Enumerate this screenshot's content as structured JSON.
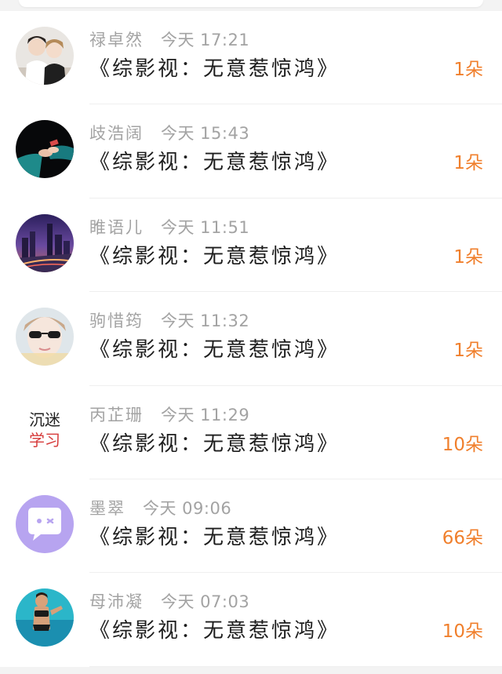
{
  "gifts": [
    {
      "name": "禄卓然",
      "time": "今天 17:21",
      "book": "《综影视：无意惹惊鸿》",
      "amount": "1朵",
      "avatar": "couple-photo-avatar"
    },
    {
      "name": "歧浩阔",
      "time": "今天 15:43",
      "book": "《综影视：无意惹惊鸿》",
      "amount": "1朵",
      "avatar": "dark-hands-avatar"
    },
    {
      "name": "睢语儿",
      "time": "今天 11:51",
      "book": "《综影视：无意惹惊鸿》",
      "amount": "1朵",
      "avatar": "city-night-avatar"
    },
    {
      "name": "驹惜筠",
      "time": "今天 11:32",
      "book": "《综影视：无意惹惊鸿》",
      "amount": "1朵",
      "avatar": "sunglasses-avatar"
    },
    {
      "name": "丙芷珊",
      "time": "今天 11:29",
      "book": "《综影视：无意惹惊鸿》",
      "amount": "10朵",
      "avatar": "text-avatar",
      "avatar_text": [
        "沉迷",
        "学习"
      ]
    },
    {
      "name": "墨翠",
      "time": "今天 09:06",
      "book": "《综影视：无意惹惊鸿》",
      "amount": "66朵",
      "avatar": "chat-bubble-avatar"
    },
    {
      "name": "母沛凝",
      "time": "今天 07:03",
      "book": "《综影视：无意惹惊鸿》",
      "amount": "10朵",
      "avatar": "pool-photo-avatar"
    }
  ],
  "colors": {
    "accent": "#f07f2c",
    "name_gray": "#a3a3a3",
    "text": "#1d1d1d",
    "background": "#f3f3f3"
  }
}
